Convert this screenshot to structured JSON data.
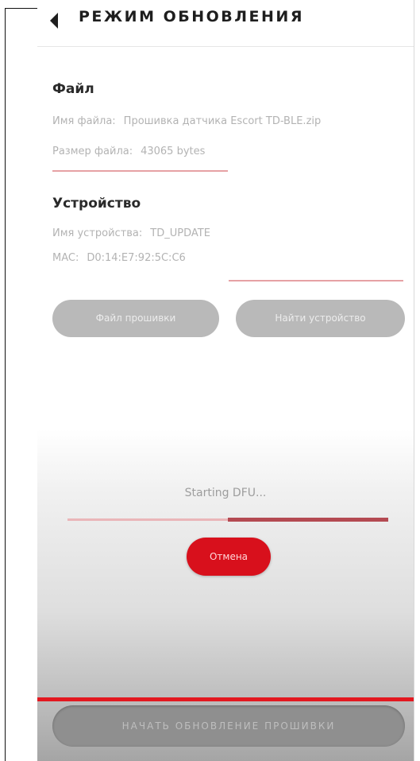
{
  "header": {
    "title": "РЕЖИМ ОБНОВЛЕНИЯ"
  },
  "file_section": {
    "title": "Файл",
    "name_label": "Имя файла:",
    "name_value": "Прошивка датчика Escort TD-BLE.zip",
    "size_label": "Размер файла:",
    "size_value": "43065 bytes"
  },
  "device_section": {
    "title": "Устройство",
    "name_label": "Имя устройства:",
    "name_value": "TD_UPDATE",
    "mac_label": "MAC:",
    "mac_value": "D0:14:E7:92:5C:C6"
  },
  "buttons": {
    "firmware_file": "Файл прошивки",
    "find_device": "Найти устройство",
    "cancel": "Отмена",
    "start_update": "НАЧАТЬ ОБНОВЛЕНИЕ ПРОШИВКИ"
  },
  "progress": {
    "status": "Starting DFU...",
    "fraction": 0.5
  },
  "colors": {
    "accent_red": "#d8101c",
    "rule_pink": "#e6a1a4",
    "button_gray": "#b9b9b9"
  }
}
